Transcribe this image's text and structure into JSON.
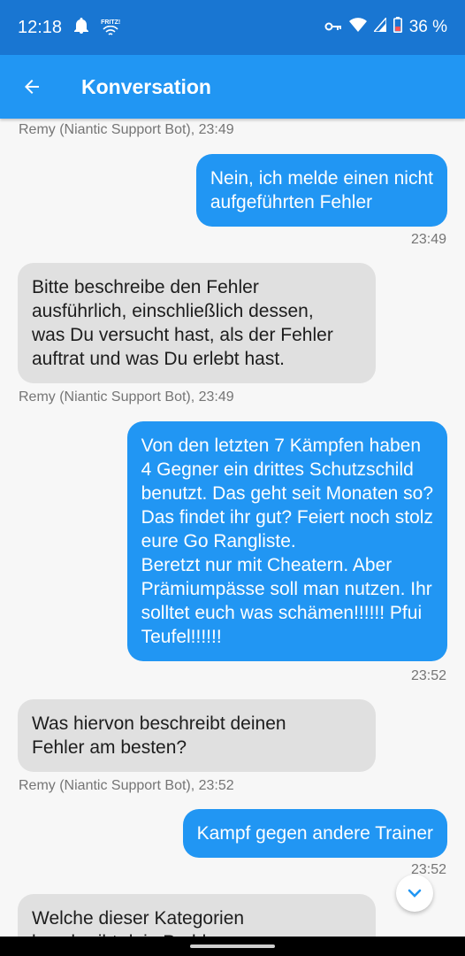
{
  "status": {
    "time": "12:18",
    "battery": "36 %",
    "fritz_label": "FRITZ!"
  },
  "appbar": {
    "title": "Konversation"
  },
  "messages": [
    {
      "type": "meta-bot",
      "text": "Remy (Niantic Support Bot), 23:49"
    },
    {
      "type": "user",
      "text": "Nein, ich melde einen nicht\naufgeführten Fehler"
    },
    {
      "type": "meta-user",
      "text": "23:49"
    },
    {
      "type": "bot",
      "text": "Bitte beschreibe den Fehler\nausführlich, einschließlich dessen,\nwas Du versucht hast, als der Fehler\nauftrat und was Du erlebt hast."
    },
    {
      "type": "meta-bot",
      "text": "Remy (Niantic Support Bot), 23:49"
    },
    {
      "type": "user",
      "text": "Von den letzten 7 Kämpfen haben\n4 Gegner ein drittes Schutzschild\nbenutzt. Das geht seit Monaten so?\nDas findet ihr gut? Feiert noch stolz\neure Go Rangliste.\nBeretzt nur mit Cheatern. Aber\nPrämiumpässe soll man nutzen. Ihr\nsolltet euch was schämen!!!!!! Pfui\nTeufel!!!!!!"
    },
    {
      "type": "meta-user",
      "text": "23:52"
    },
    {
      "type": "bot",
      "text": "Was hiervon beschreibt deinen\nFehler am besten?"
    },
    {
      "type": "meta-bot",
      "text": "Remy (Niantic Support Bot), 23:52"
    },
    {
      "type": "user",
      "text": "Kampf gegen andere Trainer"
    },
    {
      "type": "meta-user",
      "text": "23:52"
    },
    {
      "type": "bot",
      "text": "Welche dieser Kategorien\nbeschreibt dein Problem"
    }
  ],
  "colors": {
    "statusbar": "#1976d2",
    "appbar": "#2196f3",
    "user_bubble": "#2196f3",
    "bot_bubble": "#e0e0e0"
  },
  "icons": {
    "back": "arrow-left-icon",
    "scroll": "chevron-down-icon"
  }
}
